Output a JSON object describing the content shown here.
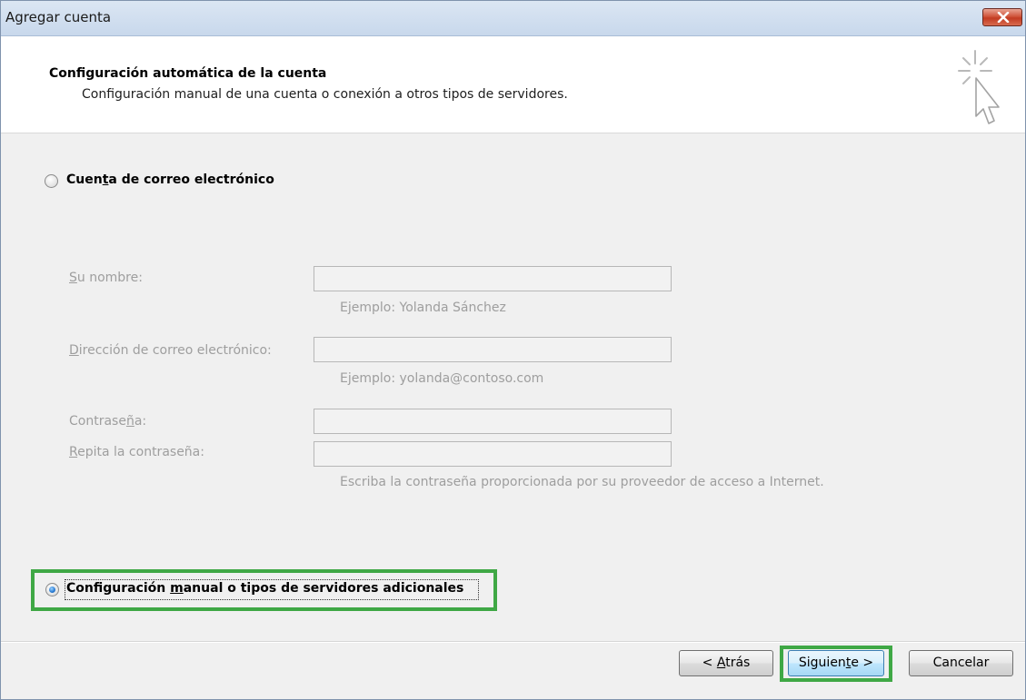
{
  "window": {
    "title": "Agregar cuenta"
  },
  "header": {
    "title": "Configuración automática de la cuenta",
    "subtitle": "Configuración manual de una cuenta o conexión a otros tipos de servidores."
  },
  "options": {
    "email_account": {
      "label_before": "Cuen",
      "label_mnemonic": "t",
      "label_after": "a de correo electrónico",
      "selected": false
    },
    "manual": {
      "label_before": "Configuración ",
      "label_mnemonic": "m",
      "label_after": "anual o tipos de servidores adicionales",
      "selected": true
    }
  },
  "fields": {
    "name": {
      "label_mnemonic": "S",
      "label_rest": "u nombre:",
      "value": "",
      "hint": "Ejemplo: Yolanda Sánchez"
    },
    "email": {
      "label_mnemonic": "D",
      "label_rest": "irección de correo electrónico:",
      "value": "",
      "hint": "Ejemplo: yolanda@contoso.com"
    },
    "password": {
      "label_before": "Contrase",
      "label_mnemonic": "ñ",
      "label_after": "a:",
      "value": ""
    },
    "password_repeat": {
      "label_mnemonic": "R",
      "label_rest": "epita la contraseña:",
      "value": "",
      "hint": "Escriba la contraseña proporcionada por su proveedor de acceso a Internet."
    }
  },
  "buttons": {
    "back": {
      "prefix": "< ",
      "mnemonic": "A",
      "rest": "trás"
    },
    "next": {
      "before": "Siguien",
      "mnemonic": "t",
      "after": "e >"
    },
    "cancel": "Cancelar"
  },
  "colors": {
    "highlight": "#3fa845",
    "disabled_text": "#9e9e9e",
    "radio_selected": "#2d7fd6"
  },
  "icons": {
    "close": "close-icon",
    "wizard": "cursor-sparkle-icon"
  }
}
